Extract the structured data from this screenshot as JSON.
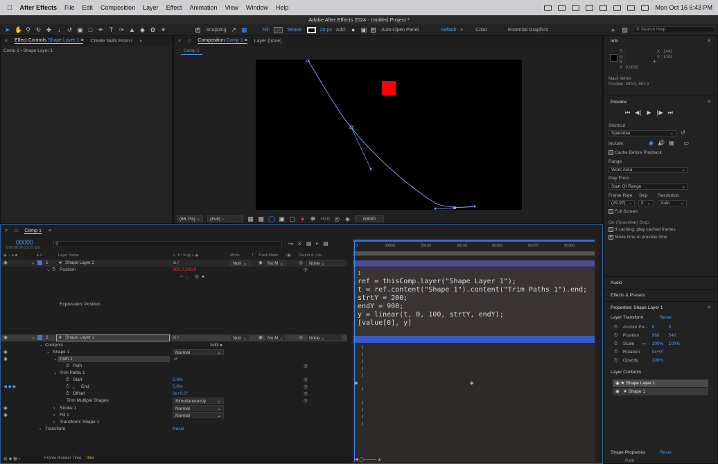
{
  "menubar": {
    "app_name": "After Effects",
    "items": [
      "File",
      "Edit",
      "Composition",
      "Layer",
      "Effect",
      "Animation",
      "View",
      "Window",
      "Help"
    ],
    "clock": "Mon Oct 16  6:43 PM"
  },
  "window_title": "Adobe After Effects 2024 - Untitled Project *",
  "toolbar": {
    "snapping_label": "Snapping",
    "fill_label": "Fill:",
    "stroke_label": "Stroke:",
    "stroke_width": "20 px",
    "add_label": "Add:",
    "auto_open_label": "Auto-Open Panel",
    "workspaces": [
      "Default",
      "Color",
      "Essential Graphics"
    ],
    "search_placeholder": "Search Help"
  },
  "effect_controls": {
    "tab_label": "Effect Controls",
    "tab_layer": "Shape Layer 1",
    "create_nulls_label": "Create Nulls From I",
    "breadcrumb": "Comp 1 • Shape Layer 1"
  },
  "composition_panel": {
    "tab_label": "Composition",
    "tab_comp": "Comp 1",
    "layer_tab": "Layer (none)",
    "breadcrumb": "Comp 1",
    "zoom": "(66.7%)",
    "resolution": "(Full)",
    "exposure": "+0.0",
    "timecode": "00000"
  },
  "timeline": {
    "tab_label": "Comp 1",
    "timecode": "00000",
    "fps": "0:00:00:00 (29.97 fps)",
    "columns": {
      "layer_name": "Layer Name",
      "mode": "Mode",
      "t": "T",
      "track_matte": "Track Matte",
      "parent": "Parent & Link"
    },
    "ruler": [
      "00050",
      "00100",
      "00150",
      "00200",
      "00250",
      "00300"
    ],
    "ruler_zero": "0",
    "layer2": {
      "num": "1",
      "name": "Shape Layer 2",
      "mode": "Norr",
      "matte": "No M",
      "parent": "None"
    },
    "position_label": "Position",
    "position_value": "960.0,300.0",
    "expression_label": "Expression: Position",
    "layer1": {
      "num": "2",
      "name": "Shape Layer 1",
      "mode": "Norr",
      "matte": "No M",
      "parent": "None"
    },
    "rows": [
      {
        "label": "Contents",
        "value": "Add:"
      },
      {
        "label": "Shape 1",
        "value": "Normal"
      },
      {
        "label": "Path 1",
        "value": ""
      },
      {
        "label": "Path",
        "value": ""
      },
      {
        "label": "Trim Paths 1",
        "value": ""
      },
      {
        "label": "Start",
        "value": "0.0%"
      },
      {
        "label": "End",
        "value": "0.0%"
      },
      {
        "label": "Offset",
        "value": "0x+0.0°"
      },
      {
        "label": "Trim Multiple Shapes",
        "value": "Simultaneously"
      },
      {
        "label": "Stroke 1",
        "value": "Normal"
      },
      {
        "label": "Fill 1",
        "value": "Normal"
      },
      {
        "label": "Transform: Shape 1",
        "value": ""
      },
      {
        "label": "Transform",
        "value": "Reset"
      }
    ],
    "footer_label": "Frame Render Time",
    "footer_value": "0ms",
    "expression_lines": [
      "ref = thisComp.layer(\"Shape Layer 1\");",
      "t = ref.content(\"Shape 1\").content(\"Trim Paths 1\").end;",
      "strtY = 200;",
      "endY = 900;",
      "y = linear(t, 0, 100, strtY, endY);",
      "[value[0], y]"
    ],
    "cursor_marker": "I"
  },
  "info_panel": {
    "title": "Info",
    "r": "R :",
    "g": "G :",
    "b": "B :",
    "a": "A : 0.0000",
    "x": "X : 1442",
    "y": "Y : 1091",
    "note1": "Mask Vertex",
    "note2": "Position: 480.0, 357.0"
  },
  "preview_panel": {
    "title": "Preview",
    "shortcut_label": "Shortcut",
    "shortcut_value": "Spacebar",
    "include_label": "Include:",
    "cache_label": "Cache Before Playback",
    "range_label": "Range",
    "range_value": "Work Area",
    "play_from_label": "Play From",
    "play_from_value": "Start Of Range",
    "frame_rate_label": "Frame Rate",
    "skip_label": "Skip",
    "resolution_label": "Resolution",
    "frame_rate_value": "(29.97)",
    "skip_value": "0",
    "resolution_value": "Auto",
    "full_screen_label": "Full Screen",
    "stop_label": "On (Spacebar) Stop:",
    "if_caching_label": "If caching, play cached frames",
    "move_time_label": "Move time to preview time"
  },
  "audio_label": "Audio",
  "effects_presets_label": "Effects & Presets",
  "properties": {
    "title": "Properties: Shape Layer 1",
    "layer_transform": "Layer Transform",
    "reset": "Reset",
    "anchor_label": "Anchor Po...",
    "anchor_x": "0",
    "anchor_y": "0",
    "position_label": "Position",
    "position_x": "960",
    "position_y": "540",
    "scale_label": "Scale",
    "scale_x": "100%",
    "scale_y": "100%",
    "rotation_label": "Rotation",
    "rotation_value": "0x+0°",
    "opacity_label": "Opacity",
    "opacity_value": "100%",
    "layer_contents": "Layer Contents",
    "content_items": [
      "Shape Layer 1",
      "Shape 1"
    ],
    "shape_properties": "Shape Properties",
    "shape_reset": "Reset",
    "path_label": "Path"
  },
  "colors": {
    "accent": "#4b9cf5",
    "red_square": "#ff0000",
    "curve": "#7b95f2"
  }
}
